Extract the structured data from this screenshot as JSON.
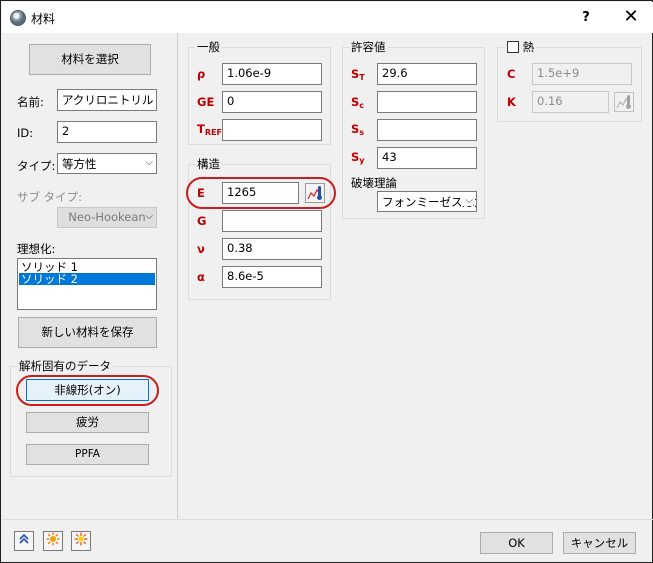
{
  "window": {
    "title": "材料",
    "help": "?",
    "close": "✕"
  },
  "left": {
    "select_material_button": "材料を選択",
    "name_label": "名前:",
    "name_value": "アクリロニトリル ブタジ",
    "id_label": "ID:",
    "id_value": "2",
    "type_label": "タイプ:",
    "type_value": "等方性",
    "subtype_label": "サブ タイプ:",
    "subtype_value": "Neo-Hookean",
    "idealization_label": "理想化:",
    "idealization_items": [
      "ソリッド 1",
      "ソリッド 2"
    ],
    "save_button": "新しい材料を保存",
    "analysis_group_title": "解析固有のデータ",
    "nonlinear_button": "非線形(オン)",
    "fatigue_button": "疲労",
    "ppfa_button": "PPFA"
  },
  "general": {
    "title": "一般",
    "rho": {
      "symbol": "ρ",
      "value": "1.06e-9"
    },
    "ge": {
      "symbol": "GE",
      "value": "0"
    },
    "tref": {
      "symbol": "T",
      "sub": "REF",
      "value": ""
    }
  },
  "structural": {
    "title": "構造",
    "e": {
      "symbol": "E",
      "value": "1265"
    },
    "g": {
      "symbol": "G",
      "value": ""
    },
    "nu": {
      "symbol": "ν",
      "value": "0.38"
    },
    "alpha": {
      "symbol": "α",
      "value": "8.6e-5"
    }
  },
  "allowable": {
    "title": "許容値",
    "st": {
      "symbol": "S",
      "sub": "T",
      "value": "29.6"
    },
    "sc": {
      "symbol": "S",
      "sub": "c",
      "value": ""
    },
    "ss": {
      "symbol": "S",
      "sub": "s",
      "value": ""
    },
    "sy": {
      "symbol": "S",
      "sub": "y",
      "value": "43"
    },
    "failure_label": "破壊理論",
    "failure_value": "フォンミーゼス応力"
  },
  "thermal": {
    "title": "熱",
    "c": {
      "symbol": "C",
      "value": "1.5e+9"
    },
    "k": {
      "symbol": "K",
      "value": "0.16"
    }
  },
  "footer": {
    "ok": "OK",
    "cancel": "キャンセル"
  }
}
